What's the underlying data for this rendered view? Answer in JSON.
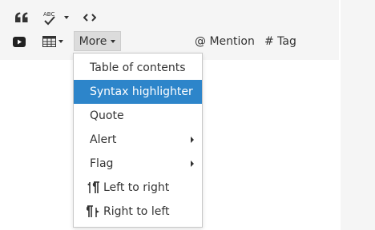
{
  "toolbar": {
    "row1": [
      {
        "name": "blockquote",
        "icon": "quote-icon"
      },
      {
        "name": "spellcheck",
        "icon": "spellcheck-icon",
        "badge": "ABC"
      },
      {
        "name": "spellcheck-menu",
        "icon": "chevron-down-icon"
      },
      {
        "name": "code",
        "icon": "code-icon"
      }
    ],
    "row2": [
      {
        "name": "media",
        "icon": "youtube-icon"
      },
      {
        "name": "table",
        "icon": "table-icon"
      }
    ],
    "more_label": "More",
    "mention_label": "@ Mention",
    "tag_label": "# Tag"
  },
  "more_menu": {
    "items": [
      {
        "label": "Table of contents",
        "active": false,
        "has_submenu": false
      },
      {
        "label": "Syntax highlighter",
        "active": true,
        "has_submenu": false
      },
      {
        "label": "Quote",
        "active": false,
        "has_submenu": false
      },
      {
        "label": "Alert",
        "active": false,
        "has_submenu": true
      },
      {
        "label": "Flag",
        "active": false,
        "has_submenu": true
      },
      {
        "label": "Left to right",
        "active": false,
        "has_submenu": false,
        "icon": "ltr-icon"
      },
      {
        "label": "Right to left",
        "active": false,
        "has_submenu": false,
        "icon": "rtl-icon"
      }
    ]
  },
  "colors": {
    "toolbar_bg": "#f5f5f5",
    "active_item_bg": "#2d85ca",
    "active_item_text": "#ffffff",
    "text": "#333333"
  }
}
